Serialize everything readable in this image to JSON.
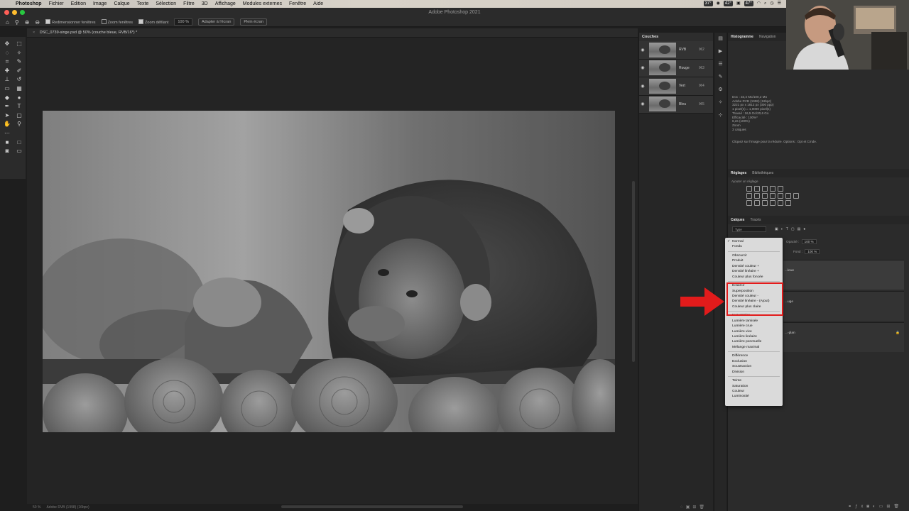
{
  "menubar": {
    "items": [
      "Photoshop",
      "Fichier",
      "Edition",
      "Image",
      "Calque",
      "Texte",
      "Sélection",
      "Filtre",
      "3D",
      "Affichage",
      "Modules externes",
      "Fenêtre",
      "Aide"
    ],
    "status": [
      "37°",
      "42°",
      "47°"
    ]
  },
  "window": {
    "title": "Adobe Photoshop 2021"
  },
  "options_bar": {
    "resize_windows": "Redimensionner fenêtres",
    "zoom_windows": "Zoom fenêtres",
    "zoom_scroll": "Zoom défilant",
    "zoom_value": "100 %",
    "fit_screen": "Adapter à l'écran",
    "full_screen": "Plein écran"
  },
  "document": {
    "tab_title": "DSC_0739-singe.psd @ 50% (couche bleue, RVB/16*) *",
    "zoom": "50 %",
    "profile": "Adobe RVB (1998) (16bpc)"
  },
  "channels_panel": {
    "title": "Couches",
    "channels": [
      {
        "name": "RVB",
        "shortcut": "⌘2"
      },
      {
        "name": "Rouge",
        "shortcut": "⌘3"
      },
      {
        "name": "Vert",
        "shortcut": "⌘4"
      },
      {
        "name": "Bleu",
        "shortcut": "⌘5"
      }
    ]
  },
  "info_panel": {
    "tabs": [
      "Histogramme",
      "Navigation"
    ],
    "lines": [
      "Doc : 33,4 Mo/100,2 Mo",
      "Adobe RVB (1998) (16bpc)",
      "3221 px x 1812 px (300 ppp)",
      "1 pixel(s) = 1,0000 pixel(s)",
      "Travail : 16,5 Go/20,6 Go",
      "Efficacité : 100%*",
      "6,2s (100%)",
      "Zoom",
      "3 calques"
    ],
    "hint": "Cliquez sur l'image pour la réduire. Options : Opt et Cmde."
  },
  "adjustments_panel": {
    "tabs": [
      "Réglages",
      "Bibliothèques"
    ],
    "subtitle": "Ajouter un réglage"
  },
  "layers_panel": {
    "tabs": [
      "Calques",
      "Tracés"
    ],
    "kind_filter": "Type",
    "opacity_label": "Opacité :",
    "opacity_value": "100 %",
    "fill_label": "Fond :",
    "fill_value": "100 %",
    "layers": [
      "...leue",
      "...uge",
      "...-plan"
    ]
  },
  "blend_menu": {
    "groups": [
      [
        "Normal",
        "Fondu"
      ],
      [
        "Obscurcir",
        "Produit",
        "Densité couleur +",
        "Densité linéaire +",
        "Couleur plus foncée"
      ],
      [
        "Eclaircir",
        "Superposition",
        "Densité couleur -",
        "Densité linéaire - (Ajout)",
        "Couleur plus claire"
      ],
      [
        "Incrustation",
        "Lumière tamisée",
        "Lumière crue",
        "Lumière vive",
        "Lumière linéaire",
        "Lumière ponctuelle",
        "Mélange maximal"
      ],
      [
        "Différence",
        "Exclusion",
        "Soustraction",
        "Division"
      ],
      [
        "Teinte",
        "Saturation",
        "Couleur",
        "Luminosité"
      ]
    ],
    "selected": "Normal",
    "highlight_color": "#e21b1b"
  },
  "colors": {
    "accent_red": "#e21b1b",
    "panel_bg": "#2b2b2b"
  }
}
